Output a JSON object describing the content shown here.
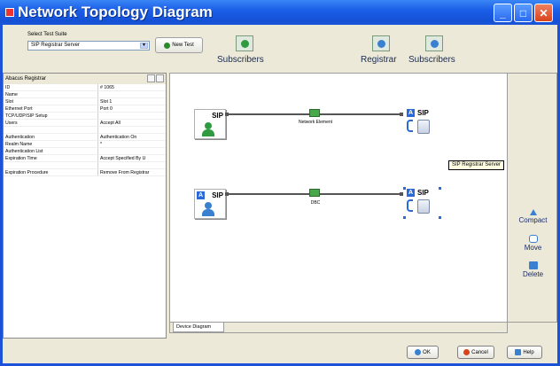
{
  "window": {
    "title": "Network Topology Diagram",
    "minimize_glyph": "_",
    "maximize_glyph": "□",
    "close_glyph": "✕"
  },
  "toolbar": {
    "suite_label": "Select Test Suite",
    "suite_value": "SIP Registrar Server",
    "new_test_label": "New Test",
    "groups": [
      {
        "label": "Subscribers",
        "icon": "subscriber-sip-icon"
      },
      {
        "label": "Registrar",
        "icon": "registrar-sip-icon"
      },
      {
        "label": "Subscribers",
        "icon": "subscriber-sip-icon-2"
      }
    ]
  },
  "properties": {
    "header": "Abacus Registrar",
    "rows": [
      {
        "key": "ID",
        "value": "# 1065"
      },
      {
        "key": "Name",
        "value": ""
      },
      {
        "key": "Slot",
        "value": "Slot 1"
      },
      {
        "key": "Ethernet Port",
        "value": "Port 0"
      },
      {
        "key": "TCP/UDP/SIP Setup",
        "value": ""
      },
      {
        "key": "Users",
        "value": "Accept All"
      },
      {
        "key": "",
        "value": "",
        "grey": true
      },
      {
        "key": "Authentication",
        "value": "Authentication On"
      },
      {
        "key": "Realm Name",
        "value": "*"
      },
      {
        "key": "Authentication List",
        "value": ""
      },
      {
        "key": "Expiration Time",
        "value": "Accept Specified By U"
      },
      {
        "key": "",
        "value": "",
        "grey": true
      },
      {
        "key": "Expiration Procedure",
        "value": "Remove From Registrar"
      }
    ]
  },
  "diagram": {
    "links": [
      {
        "label": "Network Element"
      },
      {
        "label": "DBC"
      }
    ],
    "nodes": [
      {
        "name": "subscriber-1",
        "badge": "SIP"
      },
      {
        "name": "registrar-server-1",
        "badge": "SIP",
        "a": "A"
      },
      {
        "name": "subscriber-2",
        "badge": "SIP",
        "a": "A"
      },
      {
        "name": "registrar-server-2",
        "badge": "SIP",
        "a": "A"
      }
    ],
    "tooltip": "SIP Registrar Server",
    "tab": "Device Diagram"
  },
  "side_actions": {
    "compact": "Compact",
    "move": "Move",
    "delete": "Delete"
  },
  "footer": {
    "ok": "OK",
    "cancel": "Cancel",
    "help": "Help"
  }
}
